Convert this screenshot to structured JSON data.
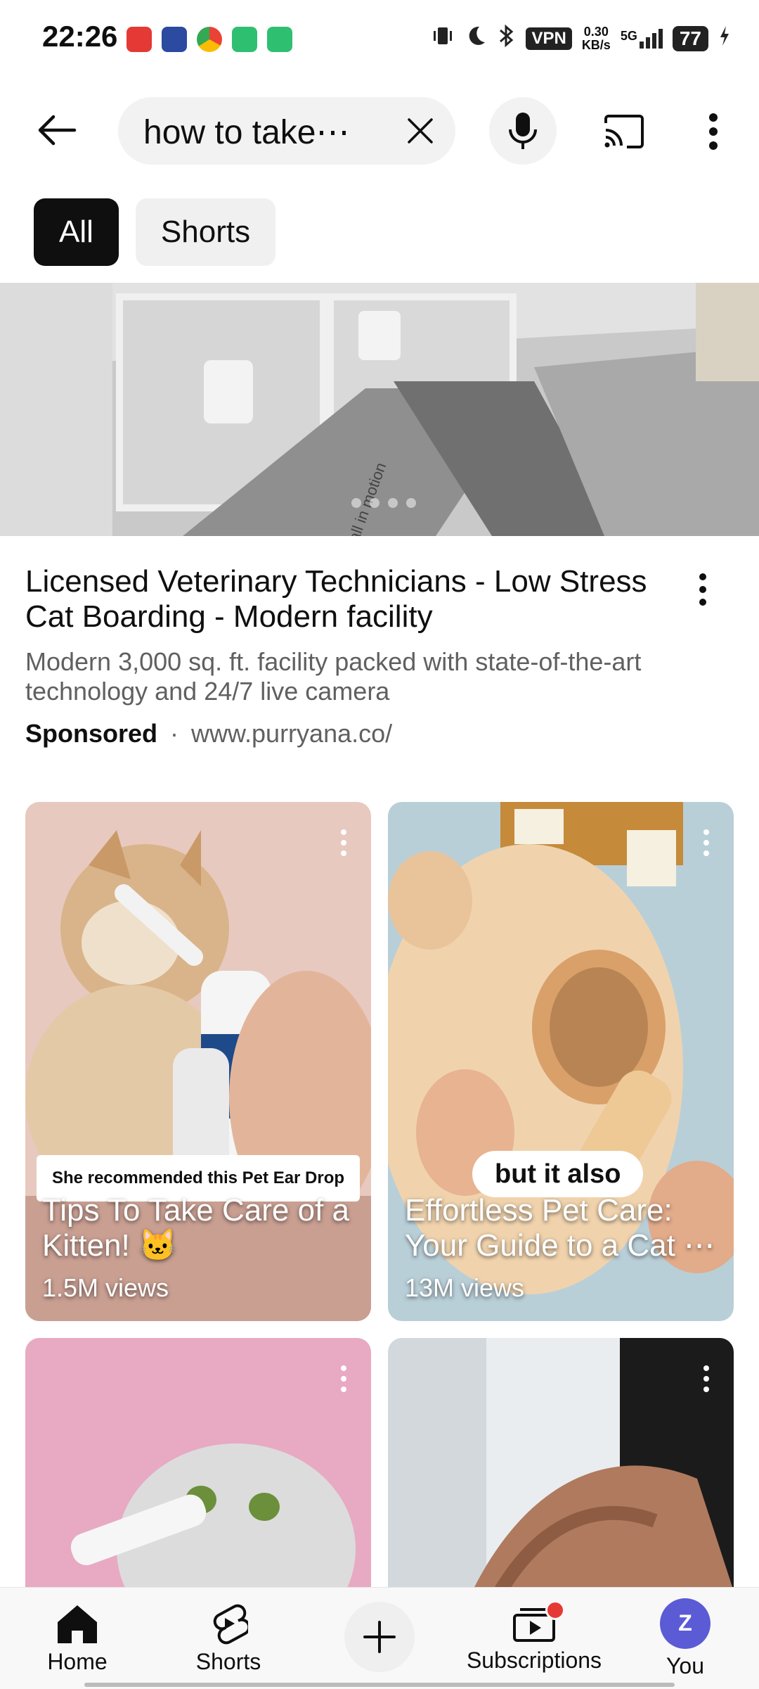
{
  "status_bar": {
    "time": "22:26",
    "vpn": "VPN",
    "speed_value": "0.30",
    "speed_unit": "KB/s",
    "network": "5G",
    "battery": "77"
  },
  "search": {
    "query": "how to take⋯"
  },
  "chips": [
    {
      "label": "All",
      "active": true
    },
    {
      "label": "Shorts",
      "active": false
    }
  ],
  "ad": {
    "title": "Licensed Veterinary Technicians - Low Stress Cat Boarding - Modern facility",
    "description": "Modern 3,000 sq. ft. facility packed with state-of-the-art technology and 24/7 live camera",
    "sponsored": "Sponsored",
    "separator": "·",
    "url": "www.purryana.co/",
    "image_text": "all in motion"
  },
  "shorts": [
    {
      "title": "Tips To Take Care of a Kitten! 🐱",
      "views": "1.5M views",
      "caption": "She recommended this Pet Ear Drop"
    },
    {
      "title": "Effortless Pet Care: Your Guide to a Cat ⋯",
      "views": "13M views",
      "caption": "but it also"
    },
    {
      "title": "",
      "views": ""
    },
    {
      "title": "",
      "views": ""
    }
  ],
  "bottom_nav": {
    "home": "Home",
    "shorts": "Shorts",
    "subscriptions": "Subscriptions",
    "you": "You",
    "avatar_letter": "Z"
  },
  "colors": {
    "accent_red": "#e53935",
    "avatar": "#5b5bd6",
    "chip_active": "#0f0f0f"
  }
}
